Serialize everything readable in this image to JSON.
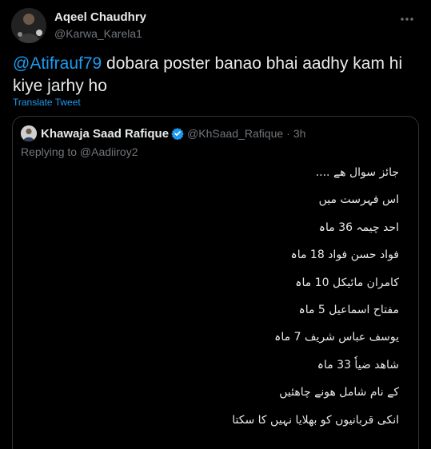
{
  "author": {
    "name": "Aqeel Chaudhry",
    "handle": "@Karwa_Karela1",
    "avatar_icon": "profile-photo"
  },
  "more_icon": "more-horizontal-icon",
  "tweet": {
    "mention": "@Atifrauf79",
    "text": " dobara poster banao bhai aadhy kam hi kiye jarhy ho"
  },
  "translate_label": "Translate Tweet",
  "quoted": {
    "name": "Khawaja Saad Rafique",
    "verified_icon": "verified-badge-icon",
    "handle": "@KhSaad_Rafique",
    "separator": "·",
    "time": "3h",
    "replying_to": "Replying to @Aadiiroy2",
    "lines": [
      "جائز سوال ھے ....",
      "اس فہرست میں",
      "احد چیمہ 36 ماہ",
      "فواد حسن فواد 18 ماہ",
      "کامران مائیکل  10 ماہ",
      "مفتاح اسماعیل  5 ماہ",
      "یوسف عباس شریف  7 ماہ",
      "شاھد ضیاٗ  33 ماہ",
      "کے نام  شامل ھونے چاھئیں",
      "انکی قربانیوں کو بھلایا نہیں کا سکتا"
    ]
  },
  "colors": {
    "background": "#000000",
    "text": "#e7e9ea",
    "muted": "#71767b",
    "accent": "#1d9bf0",
    "border": "#2f3336"
  }
}
